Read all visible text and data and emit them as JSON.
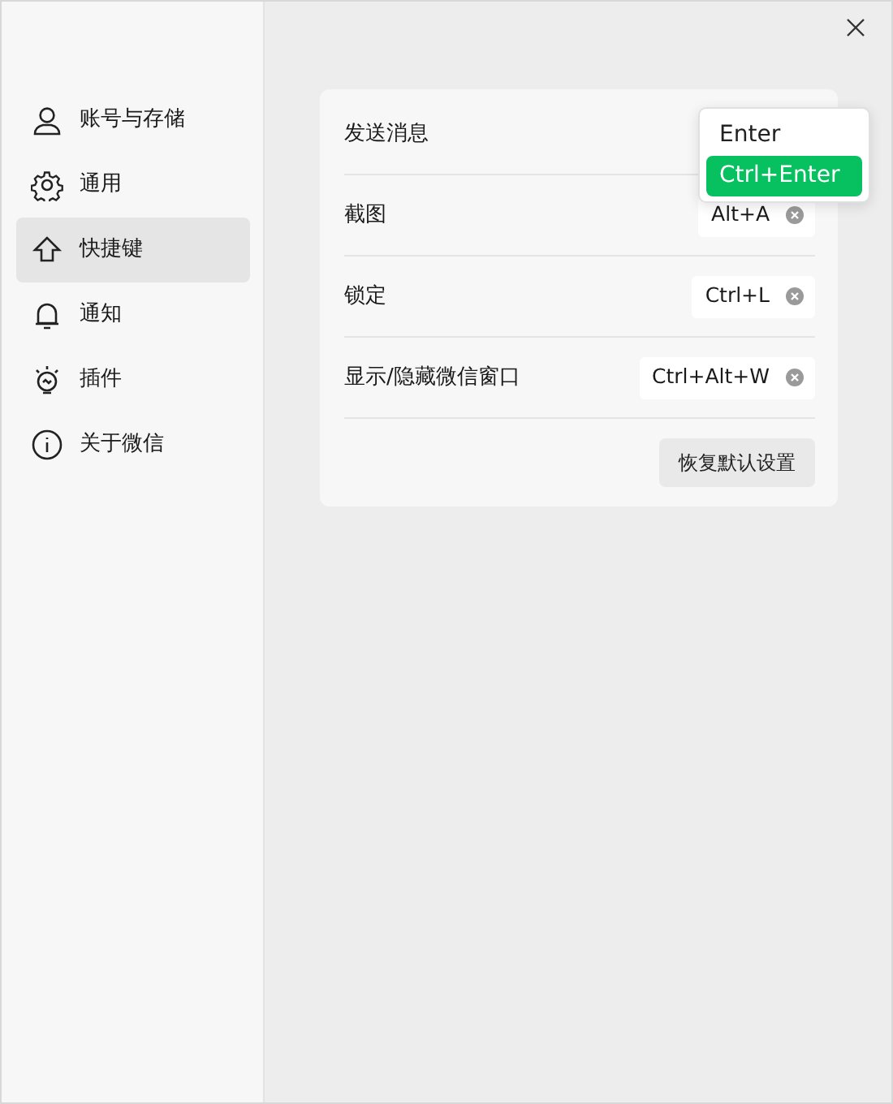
{
  "sidebar": {
    "items": [
      {
        "label": "账号与存储",
        "selected": false
      },
      {
        "label": "通用",
        "selected": false
      },
      {
        "label": "快捷键",
        "selected": true
      },
      {
        "label": "通知",
        "selected": false
      },
      {
        "label": "插件",
        "selected": false
      },
      {
        "label": "关于微信",
        "selected": false
      }
    ]
  },
  "shortcuts": [
    {
      "label": "发送消息"
    },
    {
      "label": "截图",
      "value": "Alt+A"
    },
    {
      "label": "锁定",
      "value": "Ctrl+L"
    },
    {
      "label": "显示/隐藏微信窗口",
      "value": "Ctrl+Alt+W"
    }
  ],
  "reset_button": "恢复默认设置",
  "dropdown": {
    "options": [
      {
        "label": "Enter",
        "selected": false
      },
      {
        "label": "Ctrl+Enter",
        "selected": true
      }
    ]
  }
}
